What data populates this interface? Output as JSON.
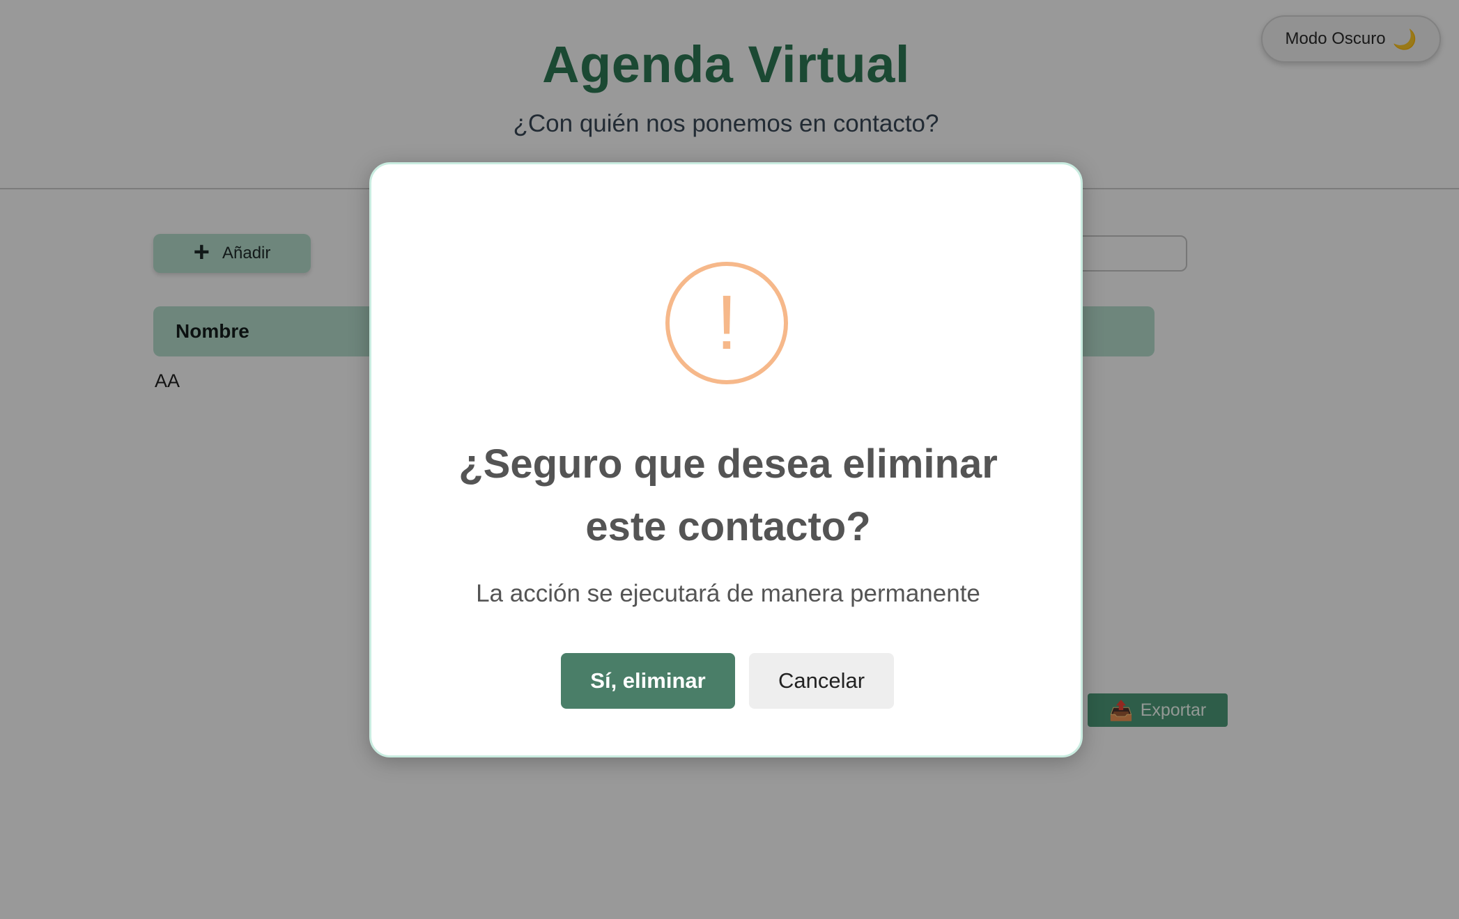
{
  "theme_toggle": {
    "label": "Modo Oscuro",
    "icon": "moon-icon",
    "glyph": "🌙"
  },
  "header": {
    "title": "Agenda Virtual",
    "subtitle": "¿Con quién nos ponemos en contacto?"
  },
  "toolbar": {
    "add_label": "Añadir",
    "add_icon": "plus-icon",
    "add_glyph": "+",
    "search_value": ""
  },
  "table": {
    "columns": [
      "Nombre"
    ],
    "rows": [
      {
        "nombre": "AA"
      }
    ]
  },
  "export": {
    "label": "Exportar",
    "icon": "inbox-icon",
    "glyph": "📤"
  },
  "modal": {
    "icon": "warning-icon",
    "glyph": "!",
    "title": "¿Seguro que desea eliminar este contacto?",
    "text": "La acción se ejecutará de manera permanente",
    "confirm_label": "Sí, eliminar",
    "cancel_label": "Cancelar"
  },
  "colors": {
    "brand_green": "#2d7a56",
    "confirm_button": "#4a7e68",
    "warning": "#f6b88a",
    "modal_border": "#c9ece0"
  }
}
